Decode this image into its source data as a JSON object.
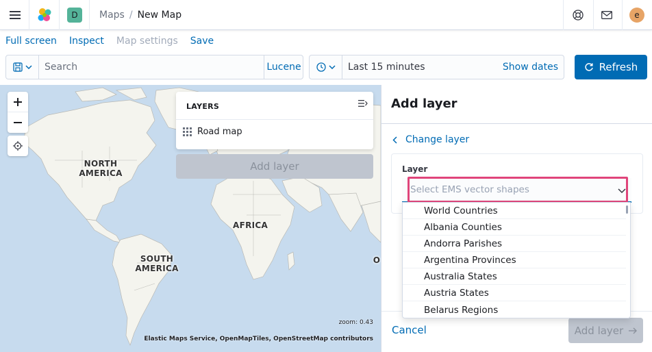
{
  "header": {
    "space_initial": "D",
    "breadcrumbs": [
      "Maps",
      "New Map"
    ],
    "breadcrumb_sep": "/",
    "user_initial": "e"
  },
  "topnav": {
    "full_screen": "Full screen",
    "inspect": "Inspect",
    "map_settings": "Map settings",
    "save": "Save"
  },
  "query": {
    "search_placeholder": "Search",
    "language": "Lucene"
  },
  "time": {
    "range": "Last 15 minutes",
    "show_dates": "Show dates",
    "refresh": "Refresh"
  },
  "map": {
    "labels": {
      "north_america": "NORTH AMERICA",
      "south_america": "SOUTH AMERICA",
      "africa": "AFRICA",
      "partial": "O"
    },
    "zoom_text": "zoom: 0.43",
    "attribution": "Elastic Maps Service, OpenMapTiles, OpenStreetMap contributors",
    "layers_title": "LAYERS",
    "layers": [
      "Road map"
    ],
    "add_layer": "Add layer",
    "colors": {
      "water": "#c7dbee",
      "land": "#f4f4ee"
    }
  },
  "flyout": {
    "title": "Add layer",
    "change_layer": "Change layer",
    "field_label": "Layer",
    "combo_placeholder": "Select EMS vector shapes",
    "options": [
      "World Countries",
      "Albania Counties",
      "Andorra Parishes",
      "Argentina Provinces",
      "Australia States",
      "Austria States",
      "Belarus Regions"
    ],
    "cancel": "Cancel",
    "add_layer": "Add layer"
  }
}
